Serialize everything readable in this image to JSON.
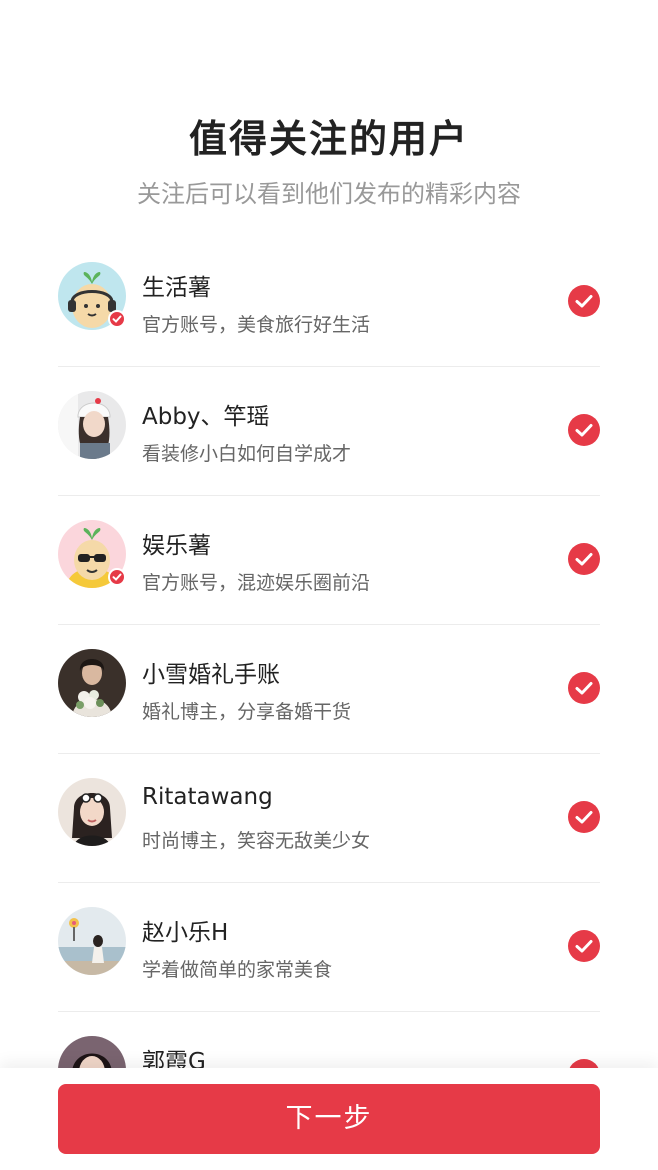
{
  "header": {
    "title": "值得关注的用户",
    "subtitle": "关注后可以看到他们发布的精彩内容"
  },
  "users": [
    {
      "name": "生活薯",
      "desc": "官方账号，美食旅行好生活",
      "avatar": "cartoon-potato-headphones",
      "verified": true,
      "selected": true
    },
    {
      "name": "Abby、竿瑶",
      "desc": "看装修小白如何自学成才",
      "avatar": "girl-white-cap-photo",
      "verified": false,
      "selected": true
    },
    {
      "name": "娱乐薯",
      "desc": "官方账号，混迹娱乐圈前沿",
      "avatar": "cartoon-potato-sunglasses",
      "verified": true,
      "selected": true
    },
    {
      "name": "小雪婚礼手账",
      "desc": "婚礼博主，分享备婚干货",
      "avatar": "wedding-flowers-photo",
      "verified": false,
      "selected": true
    },
    {
      "name": "Ritatawang",
      "desc": "时尚博主，笑容无敌美少女",
      "avatar": "girl-sunglasses-photo",
      "verified": false,
      "selected": true
    },
    {
      "name": "赵小乐H",
      "desc": "学着做简单的家常美食",
      "avatar": "girl-lakeside-photo",
      "verified": false,
      "selected": true
    },
    {
      "name": "郭霞G",
      "desc": "",
      "avatar": "girl-portrait-photo",
      "verified": false,
      "selected": true
    }
  ],
  "footer": {
    "next_label": "下一步"
  },
  "colors": {
    "accent": "#e63a47",
    "title": "#222222",
    "subtitle": "#999999",
    "desc": "#666666"
  }
}
